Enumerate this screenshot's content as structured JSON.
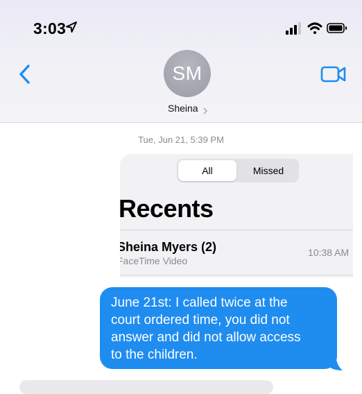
{
  "status_bar": {
    "time": "3:03",
    "icons": [
      "location-arrow-icon",
      "signal-bars-icon",
      "wifi-icon",
      "battery-icon"
    ]
  },
  "nav": {
    "back_icon": "chevron-left-icon",
    "avatar_initials": "SM",
    "contact_name": "Sheina",
    "facetime_icon": "video-camera-icon"
  },
  "thread": {
    "timestamp": "Tue, Jun 21, 5:39 PM",
    "screenshot": {
      "segments": [
        "All",
        "Missed"
      ],
      "selected_segment": "All",
      "title": "Recents",
      "entry": {
        "name": "Sheina Myers (2)",
        "type": "FaceTime Video",
        "time": "10:38 AM"
      }
    },
    "sent_message_lines": [
      "June 21st: I called twice at the",
      "court ordered time, you did not",
      "answer and did not allow access",
      "to the children."
    ]
  },
  "colors": {
    "accent": "#1f8cf0",
    "header_bg": "#eeeef6",
    "avatar": "#a2a4ae",
    "secondary_text": "#8a8a8e"
  }
}
